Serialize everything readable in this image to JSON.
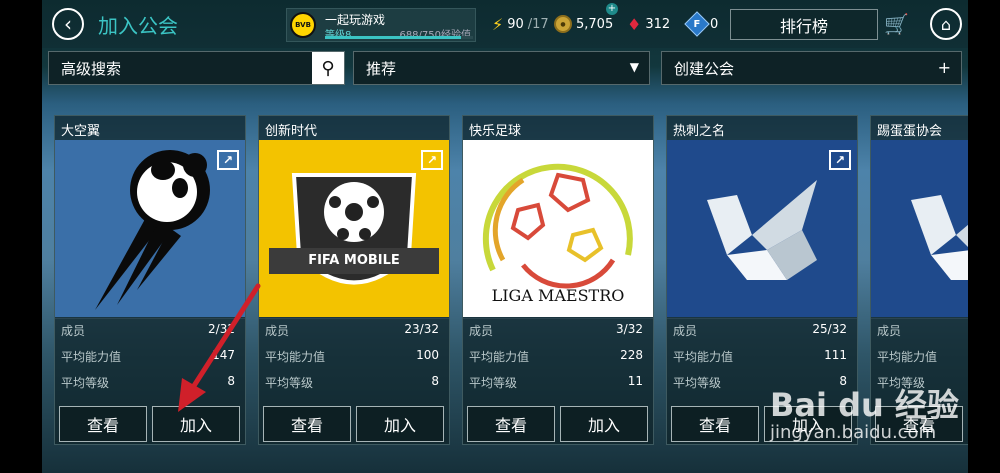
{
  "header": {
    "back_icon": "back-arrow-icon",
    "title": "加入公会",
    "profile": {
      "club_logo_text": "BVB",
      "name": "一起玩游戏",
      "level": "等级8",
      "xp": "688/750经验值",
      "xp_progress": 0.917
    },
    "energy": {
      "icon": "lightning-icon",
      "value": "90",
      "max": "/17"
    },
    "coins": {
      "icon": "coin-icon",
      "value": "5,705"
    },
    "gems": {
      "icon": "gem-icon",
      "value": "312"
    },
    "fifa_points": {
      "icon": "fifa-points-icon",
      "letter": "F",
      "value": "0"
    },
    "leaderboard_label": "排行榜",
    "cart_icon": "cart-icon",
    "home_icon": "home-icon"
  },
  "toolbar": {
    "search_label": "高级搜索",
    "filter_label": "推荐",
    "create_label": "创建公会"
  },
  "leagues": [
    {
      "name": "大空翼",
      "members": "2/32",
      "avg_ovr": "147",
      "avg_level": "8"
    },
    {
      "name": "创新时代",
      "members": "23/32",
      "avg_ovr": "100",
      "avg_level": "8",
      "logo_text": "FIFA MOBILE"
    },
    {
      "name": "快乐足球",
      "members": "3/32",
      "avg_ovr": "228",
      "avg_level": "11",
      "logo_text": "LIGA MAESTRO"
    },
    {
      "name": "热刺之名",
      "members": "25/32",
      "avg_ovr": "111",
      "avg_level": "8"
    },
    {
      "name": "踢蛋蛋协会",
      "members": "",
      "avg_ovr": "",
      "avg_level": ""
    }
  ],
  "labels": {
    "members": "成员",
    "avg_ovr": "平均能力值",
    "avg_level": "平均等级",
    "view": "查看",
    "join": "加入"
  },
  "watermark": {
    "logo": "Bai du 经验",
    "url": "jingyan.baidu.com"
  },
  "colors": {
    "accent": "#3bc4c4",
    "arrow": "#d0202a"
  }
}
